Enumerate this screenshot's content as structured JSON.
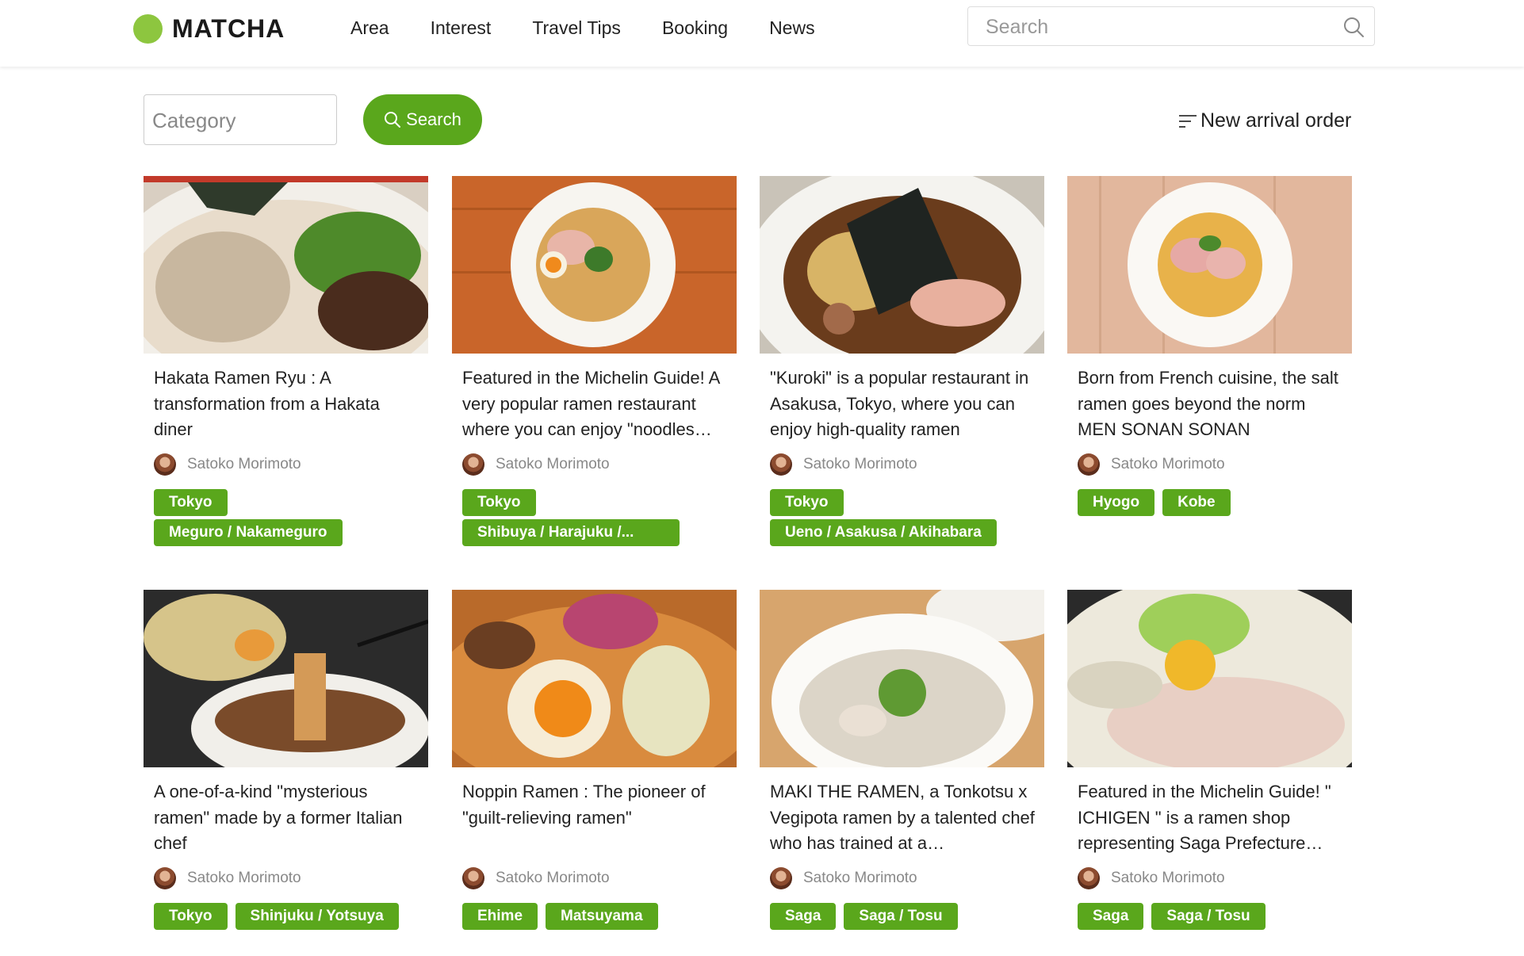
{
  "header": {
    "logo_text": "MATCHA",
    "nav": [
      "Area",
      "Interest",
      "Travel Tips",
      "Booking",
      "News"
    ],
    "search_placeholder": "Search"
  },
  "filter": {
    "category_placeholder": "Category",
    "search_label": "Search",
    "sort_label": "New arrival order"
  },
  "articles": [
    {
      "title": "Hakata Ramen Ryu : A transformation from a Hakata diner",
      "author": "Satoko Morimoto",
      "tags": [
        "Tokyo",
        "Meguro / Nakameguro"
      ]
    },
    {
      "title": "Featured in the Michelin Guide! A very popular ramen restaurant where you can enjoy \"noodles…",
      "author": "Satoko Morimoto",
      "tags": [
        "Tokyo",
        "Shibuya / Harajuku /..."
      ]
    },
    {
      "title": "\"Kuroki\" is a popular restaurant in Asakusa, Tokyo, where you can enjoy high-quality ramen",
      "author": "Satoko Morimoto",
      "tags": [
        "Tokyo",
        "Ueno / Asakusa / Akihabara"
      ]
    },
    {
      "title": "Born from French cuisine, the salt ramen goes beyond the norm MEN SONAN SONAN",
      "author": "Satoko Morimoto",
      "tags": [
        "Hyogo",
        "Kobe"
      ]
    },
    {
      "title": "A one-of-a-kind \"mysterious ramen\" made by a former Italian chef",
      "author": "Satoko Morimoto",
      "tags": [
        "Tokyo",
        "Shinjuku / Yotsuya"
      ]
    },
    {
      "title": "Noppin Ramen : The pioneer of \"guilt-relieving ramen\"",
      "author": "Satoko Morimoto",
      "tags": [
        "Ehime",
        "Matsuyama"
      ]
    },
    {
      "title": "MAKI THE RAMEN, a Tonkotsu x Vegipota ramen by a talented chef who has trained at a…",
      "author": "Satoko Morimoto",
      "tags": [
        "Saga",
        "Saga / Tosu"
      ]
    },
    {
      "title": "Featured in the Michelin Guide! \" ICHIGEN \" is a ramen shop representing Saga Prefecture…",
      "author": "Satoko Morimoto",
      "tags": [
        "Saga",
        "Saga / Tosu"
      ]
    }
  ],
  "colors": {
    "brand_green": "#5aa71c",
    "logo_green": "#8dc63f"
  }
}
